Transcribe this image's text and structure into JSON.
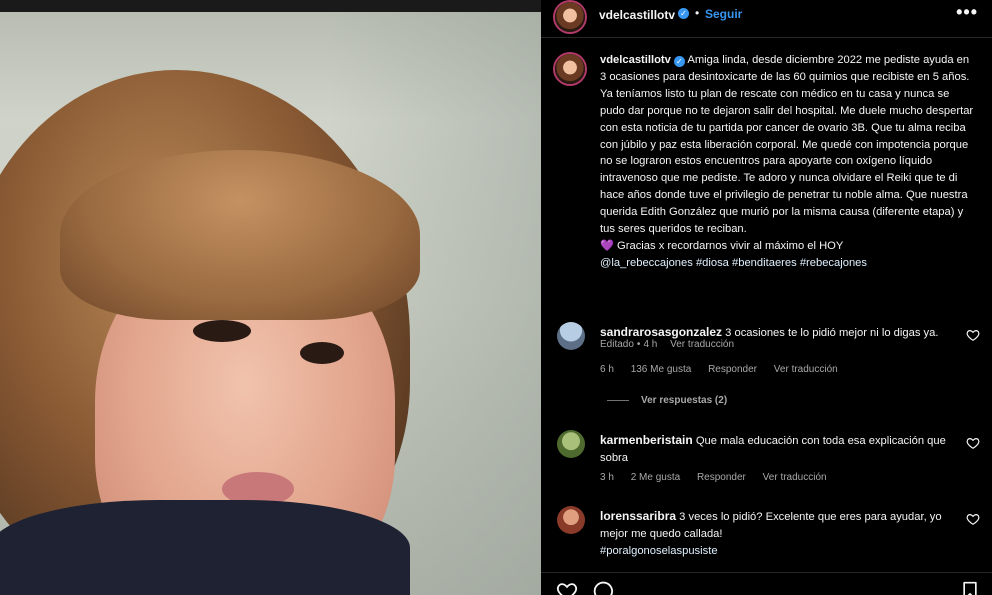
{
  "post": {
    "author": "vdelcastillotv",
    "follow_label": "Seguir",
    "separator": "•",
    "more_label": "•••",
    "verified_glyph": "✓"
  },
  "caption": {
    "username": "vdelcastillotv",
    "text": "Amiga linda, desde diciembre 2022 me pediste ayuda en 3 ocasiones para desintoxicarte de las 60 quimios que recibiste en 5 años. Ya teníamos listo tu plan de rescate con médico en tu casa y nunca se pudo dar porque no te dejaron salir del hospital. Me duele mucho despertar con esta noticia de tu partida por cancer de ovario 3B. Que tu alma reciba con júbilo y paz esta liberación corporal. Me quedé con impotencia porque no se lograron estos encuentros para apoyarte con oxígeno líquido intravenoso que me pediste. Te adoro y nunca olvidare el Reiki que te di hace años donde tuve el privilegio de penetrar tu noble alma. Que nuestra querida Edith González que murió por la misma causa (diferente etapa) y tus seres queridos te reciban.",
    "closing_emoji": "💜",
    "closing_text": "Gracias x recordarnos vivir al máximo el HOY",
    "hashtags": "@la_rebeccajones #diosa #benditaeres #rebecajones",
    "edited": "Editado",
    "time": "4 h",
    "translate": "Ver traducción"
  },
  "comments": [
    {
      "username": "sandrarosasgonzalez",
      "text": "3 ocasiones te lo pidió mejor ni lo digas ya.",
      "time": "6 h",
      "likes": "136 Me gusta",
      "reply": "Responder",
      "translate": "Ver traducción",
      "avatar_color": "#8fa9c9"
    },
    {
      "username": "karmenberistain",
      "text": "Que mala educación con toda esa explicación que sobra",
      "time": "3 h",
      "likes": "2 Me gusta",
      "reply": "Responder",
      "translate": "Ver traducción",
      "avatar_color": "#6f8a4a"
    },
    {
      "username": "lorenssaribra",
      "text": "3 veces lo pidió? Excelente que eres para ayudar, yo mejor me quedo callada!",
      "hashtag": "#poralgonoselaspusiste",
      "avatar_color": "#a8543e"
    }
  ],
  "view_replies": "Ver respuestas (2)",
  "colors": {
    "background": "#000000",
    "text": "#f5f5f5",
    "muted": "#a8a8a8",
    "link_blue": "#3897f0",
    "hashtag": "#e0f1ff"
  },
  "icons": [
    "verified-icon",
    "more-options-icon",
    "heart-icon",
    "comment-icon",
    "bookmark-icon"
  ]
}
